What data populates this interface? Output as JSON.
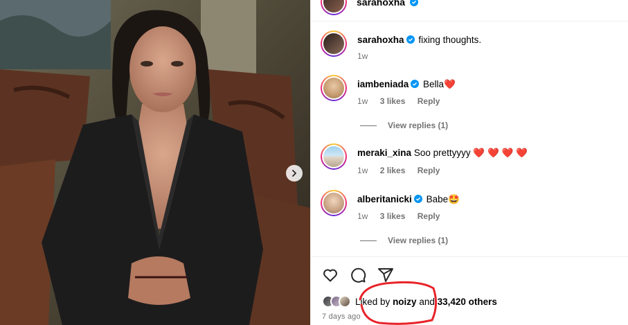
{
  "post": {
    "author": "sarahoxha",
    "verified": true,
    "carousel_next_icon": "chevron-right-icon"
  },
  "caption": {
    "user": "sarahoxha",
    "text": "fixing thoughts.",
    "time": "1w"
  },
  "comments": [
    {
      "user": "iambeniada",
      "verified": true,
      "text": "Bella",
      "emoji": "❤️",
      "time": "1w",
      "likes": "3 likes",
      "reply": "Reply",
      "view_replies": "View replies (1)"
    },
    {
      "user": "meraki_xina",
      "verified": false,
      "text": "Soo prettyyyy",
      "emoji": "❤️ ❤️ ❤️ ❤️",
      "time": "1w",
      "likes": "2 likes",
      "reply": "Reply"
    },
    {
      "user": "alberitanicki",
      "verified": true,
      "text": "Babe",
      "emoji": "🤩",
      "time": "1w",
      "likes": "3 likes",
      "reply": "Reply",
      "view_replies": "View replies (1)"
    }
  ],
  "actions": {
    "like_icon": "heart-icon",
    "comment_icon": "comment-icon",
    "share_icon": "paper-plane-icon"
  },
  "likes": {
    "prefix": "Liked by",
    "user": "noizy",
    "middle": "and",
    "count": "33,420 others"
  },
  "timestamp": "7 days ago",
  "colors": {
    "verified": "#0095f6",
    "muted": "#737373",
    "heart": "#ed1c24",
    "annotation": "#e8232a"
  }
}
